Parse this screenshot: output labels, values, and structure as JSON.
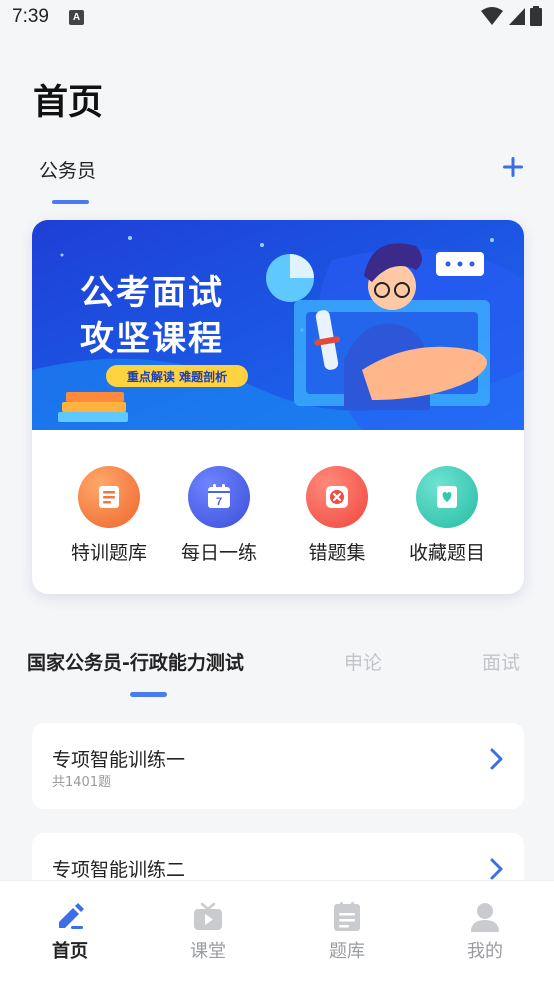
{
  "status": {
    "time": "7:39",
    "notify_glyph": "A"
  },
  "header": {
    "title": "首页",
    "category": "公务员"
  },
  "banner": {
    "line1": "公考面试",
    "line2": "攻坚课程",
    "sub": "重点解读 难题剖析"
  },
  "features": [
    {
      "label": "特训题库",
      "icon": "book-icon",
      "color": "#f5753c"
    },
    {
      "label": "每日一练",
      "icon": "calendar-icon",
      "color": "#4b63e6",
      "badge": "7"
    },
    {
      "label": "错题集",
      "icon": "wrong-icon",
      "color": "#f04c43"
    },
    {
      "label": "收藏题目",
      "icon": "bookmark-icon",
      "color": "#2fc9b1"
    }
  ],
  "tabs": [
    {
      "label": "国家公务员-行政能力测试",
      "active": true
    },
    {
      "label": "申论",
      "active": false
    },
    {
      "label": "面试",
      "active": false
    }
  ],
  "items": [
    {
      "title": "专项智能训练一",
      "count": "共1401题"
    },
    {
      "title": "专项智能训练二",
      "count": ""
    }
  ],
  "nav": [
    {
      "label": "首页",
      "icon": "pen-icon",
      "active": true
    },
    {
      "label": "课堂",
      "icon": "tv-icon",
      "active": false
    },
    {
      "label": "题库",
      "icon": "list-icon",
      "active": false
    },
    {
      "label": "我的",
      "icon": "user-icon",
      "active": false
    }
  ],
  "colors": {
    "accent": "#4a7bf0",
    "banner_bg": "#1f4fe0"
  }
}
